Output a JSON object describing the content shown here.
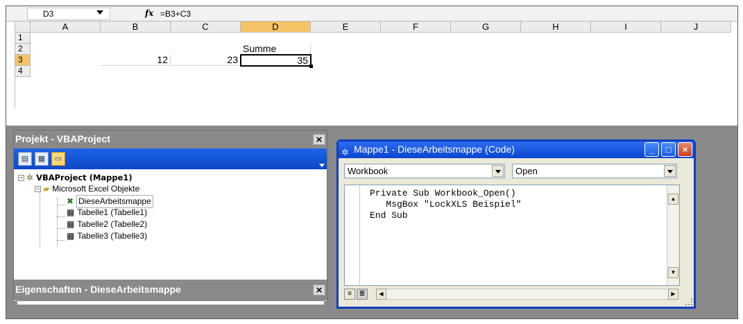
{
  "excel": {
    "name_box": "D3",
    "formula": "=B3+C3",
    "fx_icon": "fx-icon",
    "columns": [
      "A",
      "B",
      "C",
      "D",
      "E",
      "F",
      "G",
      "H",
      "I",
      "J"
    ],
    "selected_column": "D",
    "rows": [
      "1",
      "2",
      "3",
      "4"
    ],
    "selected_row": "3",
    "cells": {
      "D2": "Summe",
      "B3": "12",
      "C3": "23",
      "D3": "35"
    }
  },
  "project_panel": {
    "title": "Projekt - VBAProject",
    "close": "×",
    "toolbar": {
      "view_code_icon": "view-code-icon",
      "view_object_icon": "view-object-icon",
      "toggle_folders_icon": "folder-icon"
    },
    "tree": {
      "root": "VBAProject (Mappe1)",
      "folder": "Microsoft Excel Objekte",
      "items": [
        "DieseArbeitsmappe",
        "Tabelle1 (Tabelle1)",
        "Tabelle2 (Tabelle2)",
        "Tabelle3 (Tabelle3)"
      ]
    }
  },
  "properties_panel": {
    "title": "Eigenschaften - DieseArbeitsmappe",
    "close": "×"
  },
  "code_window": {
    "title": "Mappe1 - DieseArbeitsmappe (Code)",
    "object_combo": "Workbook",
    "procedure_combo": "Open",
    "code_lines": [
      "Private Sub Workbook_Open()",
      "   MsgBox \"LockXLS Beispiel\"",
      "End Sub"
    ],
    "buttons": {
      "minimize": "_",
      "maximize": "□",
      "close": "×"
    }
  },
  "colors": {
    "selection_header": "#f6c466",
    "xp_blue": "#0a46d0",
    "panel_gray": "#8a8a8a"
  }
}
